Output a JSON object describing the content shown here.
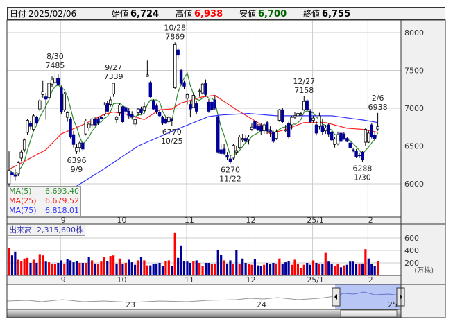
{
  "header": {
    "date_label": "日付",
    "date_value": "2025/02/06",
    "open_label": "始値",
    "open_value": "6,724",
    "high_label": "高値",
    "high_value": "6,938",
    "low_label": "安値",
    "low_value": "6,700",
    "close_label": "終値",
    "close_value": "6,755"
  },
  "colors": {
    "up_volume": "#ff0000",
    "down_volume": "#000099",
    "ma5": "#2e8b2e",
    "ma25": "#ff2020",
    "ma75": "#3333ff",
    "high_text": "#ff0000",
    "low_text": "#006400"
  },
  "legend": [
    {
      "name": "MA(5)",
      "value": "6,693.40"
    },
    {
      "name": "MA(25)",
      "value": "6,679.52"
    },
    {
      "name": "MA(75)",
      "value": "6,818.01"
    }
  ],
  "volume_legend": {
    "label": "出来高",
    "value": "2,315,600株"
  },
  "volume_unit": "(万株)",
  "navigator": {
    "labels": [
      "23",
      "24",
      "25"
    ]
  },
  "chart_data": {
    "type": "candlestick",
    "ylim": [
      5580,
      8150
    ],
    "yticks": [
      "8000",
      "7500",
      "7000",
      "6500",
      "6000"
    ],
    "ytick_values": [
      8000,
      7500,
      7000,
      6500,
      6000
    ],
    "xticks": [
      {
        "label": "9",
        "index": 17
      },
      {
        "label": "10",
        "index": 36
      },
      {
        "label": "11",
        "index": 58
      },
      {
        "label": "12",
        "index": 78
      },
      {
        "label": "25/1",
        "index": 99
      },
      {
        "label": "2",
        "index": 117
      }
    ],
    "candles": [
      [
        6000,
        6430,
        5950,
        6180
      ],
      [
        6150,
        6250,
        6080,
        6120
      ],
      [
        6120,
        6200,
        6040,
        6100
      ],
      [
        6130,
        6300,
        6100,
        6280
      ],
      [
        6340,
        6450,
        6300,
        6420
      ],
      [
        6450,
        6600,
        6420,
        6580
      ],
      [
        6680,
        6860,
        6650,
        6840
      ],
      [
        6800,
        6830,
        6720,
        6760
      ],
      [
        6720,
        6920,
        6700,
        6900
      ],
      [
        6880,
        6900,
        6780,
        6800
      ],
      [
        6990,
        7120,
        6960,
        7100
      ],
      [
        7180,
        7360,
        7140,
        7220
      ],
      [
        7150,
        7200,
        6850,
        7120
      ],
      [
        7140,
        7340,
        7100,
        7330
      ],
      [
        7320,
        7420,
        7280,
        7370
      ],
      [
        7340,
        7485,
        7320,
        7400
      ],
      [
        7400,
        7450,
        7300,
        7310
      ],
      [
        7270,
        7300,
        6920,
        6950
      ],
      [
        6980,
        7220,
        6950,
        7190
      ],
      [
        6880,
        6960,
        6820,
        6940
      ],
      [
        6860,
        6880,
        6600,
        6620
      ],
      [
        6650,
        6700,
        6480,
        6520
      ],
      [
        6430,
        6530,
        6396,
        6480
      ],
      [
        6480,
        6560,
        6420,
        6540
      ],
      [
        6540,
        6560,
        6430,
        6460
      ],
      [
        6660,
        6860,
        6640,
        6830
      ],
      [
        6740,
        6800,
        6700,
        6790
      ],
      [
        6780,
        6880,
        6740,
        6860
      ],
      [
        6850,
        6880,
        6760,
        6780
      ],
      [
        6860,
        6890,
        6780,
        6800
      ],
      [
        6880,
        6900,
        6850,
        6860
      ],
      [
        6920,
        7080,
        6900,
        7040
      ],
      [
        7060,
        7100,
        6950,
        6960
      ],
      [
        7050,
        7150,
        7020,
        7110
      ],
      [
        7190,
        7339,
        7150,
        7330
      ],
      [
        6850,
        6900,
        6800,
        6880
      ],
      [
        6940,
        7060,
        6900,
        7040
      ],
      [
        7020,
        7030,
        6800,
        6820
      ],
      [
        7010,
        7030,
        6930,
        6960
      ],
      [
        6960,
        7000,
        6860,
        6900
      ],
      [
        6920,
        6960,
        6850,
        6880
      ],
      [
        6790,
        6880,
        6750,
        6850
      ],
      [
        6940,
        7000,
        6900,
        6990
      ],
      [
        6990,
        7020,
        6920,
        6940
      ],
      [
        6970,
        7080,
        6930,
        7020
      ],
      [
        7420,
        7630,
        7420,
        7440
      ],
      [
        7340,
        7360,
        7130,
        7150
      ],
      [
        7100,
        7120,
        6980,
        6990
      ],
      [
        7030,
        7060,
        6920,
        6950
      ],
      [
        6950,
        6980,
        6880,
        6900
      ],
      [
        6880,
        6900,
        6780,
        6800
      ],
      [
        6860,
        6880,
        6790,
        6800
      ],
      [
        6820,
        6900,
        6790,
        6880
      ],
      [
        6860,
        6870,
        6770,
        6830
      ],
      [
        7270,
        7869,
        7250,
        7840
      ],
      [
        7770,
        7800,
        7650,
        7700
      ],
      [
        7500,
        7520,
        7300,
        7330
      ],
      [
        7340,
        7360,
        7250,
        7290
      ],
      [
        7130,
        7200,
        7050,
        7180
      ],
      [
        7050,
        7100,
        6880,
        6990
      ],
      [
        7010,
        7200,
        7000,
        7170
      ],
      [
        7060,
        7100,
        6920,
        6960
      ],
      [
        7220,
        7260,
        7150,
        7230
      ],
      [
        7200,
        7340,
        7180,
        7320
      ],
      [
        7330,
        7380,
        7150,
        7180
      ],
      [
        7080,
        7120,
        6940,
        6960
      ],
      [
        7080,
        7100,
        6960,
        6980
      ],
      [
        7110,
        7170,
        6980,
        7000
      ],
      [
        6890,
        6900,
        6400,
        6420
      ],
      [
        6450,
        6520,
        6380,
        6400
      ],
      [
        6460,
        6530,
        6380,
        6400
      ],
      [
        6380,
        6420,
        6320,
        6350
      ],
      [
        6330,
        6380,
        6270,
        6290
      ],
      [
        6340,
        6530,
        6320,
        6510
      ],
      [
        6420,
        6500,
        6380,
        6440
      ],
      [
        6480,
        6650,
        6460,
        6620
      ],
      [
        6580,
        6660,
        6550,
        6600
      ],
      [
        6600,
        6640,
        6540,
        6560
      ],
      [
        6580,
        6650,
        6520,
        6620
      ],
      [
        6720,
        6800,
        6700,
        6750
      ],
      [
        6830,
        6840,
        6720,
        6730
      ],
      [
        6760,
        6790,
        6700,
        6710
      ],
      [
        6770,
        6800,
        6650,
        6700
      ],
      [
        6700,
        6800,
        6660,
        6780
      ],
      [
        6810,
        6830,
        6660,
        6700
      ],
      [
        6700,
        6760,
        6620,
        6680
      ],
      [
        6680,
        6700,
        6540,
        6560
      ],
      [
        6600,
        6720,
        6580,
        6690
      ],
      [
        6840,
        6990,
        6820,
        6980
      ],
      [
        6980,
        7000,
        6800,
        6820
      ],
      [
        6700,
        6780,
        6680,
        6710
      ],
      [
        6800,
        6820,
        6600,
        6620
      ],
      [
        6780,
        6900,
        6720,
        6880
      ],
      [
        6880,
        6950,
        6860,
        6900
      ],
      [
        6900,
        6960,
        6880,
        6930
      ],
      [
        6910,
        6950,
        6900,
        6930
      ],
      [
        6980,
        7158,
        6960,
        7090
      ],
      [
        7100,
        7120,
        6960,
        6980
      ],
      [
        6960,
        6990,
        6800,
        6820
      ],
      [
        6840,
        6900,
        6800,
        6870
      ],
      [
        6780,
        6830,
        6640,
        6670
      ],
      [
        6760,
        6940,
        6720,
        6900
      ],
      [
        6770,
        6860,
        6650,
        6690
      ],
      [
        6700,
        6780,
        6660,
        6740
      ],
      [
        6780,
        6800,
        6620,
        6660
      ],
      [
        6680,
        6700,
        6560,
        6580
      ],
      [
        6520,
        6620,
        6480,
        6590
      ],
      [
        6530,
        6690,
        6510,
        6650
      ],
      [
        6670,
        6690,
        6540,
        6560
      ],
      [
        6660,
        6680,
        6580,
        6600
      ],
      [
        6600,
        6620,
        6550,
        6560
      ],
      [
        6540,
        6560,
        6470,
        6480
      ],
      [
        6450,
        6470,
        6420,
        6440
      ],
      [
        6430,
        6460,
        6340,
        6360
      ],
      [
        6380,
        6410,
        6340,
        6370
      ],
      [
        6420,
        6440,
        6288,
        6320
      ],
      [
        6550,
        6740,
        6500,
        6720
      ],
      [
        6550,
        6700,
        6540,
        6670
      ],
      [
        6780,
        6800,
        6600,
        6620
      ],
      [
        6640,
        6690,
        6580,
        6600
      ],
      [
        6724,
        6938,
        6700,
        6755
      ]
    ],
    "ma25_points": [
      [
        0,
        6190
      ],
      [
        12,
        6450
      ],
      [
        17,
        6660
      ],
      [
        24,
        6780
      ],
      [
        31,
        6920
      ],
      [
        34,
        6950
      ],
      [
        38,
        6920
      ],
      [
        44,
        6850
      ],
      [
        49,
        6980
      ],
      [
        53,
        6990
      ],
      [
        56,
        7070
      ],
      [
        63,
        7150
      ],
      [
        67,
        7170
      ],
      [
        74,
        6980
      ],
      [
        81,
        6810
      ],
      [
        85,
        6660
      ],
      [
        90,
        6720
      ],
      [
        96,
        6810
      ],
      [
        103,
        6810
      ],
      [
        110,
        6735
      ],
      [
        115,
        6720
      ],
      [
        120,
        6680
      ]
    ],
    "ma75_points": [
      [
        22,
        5970
      ],
      [
        31,
        6200
      ],
      [
        42,
        6500
      ],
      [
        54,
        6710
      ],
      [
        65,
        6890
      ],
      [
        69,
        6910
      ],
      [
        78,
        6930
      ],
      [
        87,
        6900
      ],
      [
        96,
        6900
      ],
      [
        105,
        6900
      ],
      [
        115,
        6845
      ],
      [
        120,
        6810
      ]
    ],
    "annotations": [
      {
        "date": "8/30",
        "price": "7485",
        "index": 15,
        "at": "high"
      },
      {
        "date": "9/9",
        "price": "6396",
        "index": 22,
        "at": "low"
      },
      {
        "date": "9/27",
        "price": "7339",
        "index": 34,
        "at": "high"
      },
      {
        "date": "10/25",
        "price": "6770",
        "index": 53,
        "at": "low"
      },
      {
        "date": "10/28",
        "price": "7869",
        "index": 54,
        "at": "high"
      },
      {
        "date": "11/22",
        "price": "6270",
        "index": 72,
        "at": "low"
      },
      {
        "date": "12/27",
        "price": "7158",
        "index": 96,
        "at": "high"
      },
      {
        "date": "1/30",
        "price": "6288",
        "index": 115,
        "at": "low"
      },
      {
        "date": "2/6",
        "price": "6938",
        "index": 120,
        "at": "high"
      }
    ],
    "volume": {
      "yticks": [
        "600",
        "400",
        "200"
      ],
      "ytick_values": [
        600,
        400,
        200
      ],
      "values": [
        440,
        320,
        380,
        250,
        230,
        270,
        280,
        200,
        250,
        200,
        340,
        320,
        220,
        210,
        180,
        180,
        200,
        240,
        190,
        260,
        240,
        210,
        230,
        200,
        200,
        200,
        290,
        240,
        190,
        180,
        220,
        290,
        230,
        310,
        320,
        190,
        270,
        180,
        200,
        250,
        210,
        170,
        240,
        300,
        240,
        160,
        160,
        180,
        190,
        200,
        150,
        230,
        240,
        150,
        680,
        280,
        480,
        230,
        220,
        200,
        230,
        240,
        200,
        150,
        200,
        200,
        180,
        190,
        400,
        330,
        240,
        190,
        240,
        180,
        400,
        180,
        270,
        200,
        180,
        170,
        260,
        160,
        150,
        170,
        200,
        180,
        200,
        190,
        270,
        180,
        210,
        230,
        170,
        250,
        180,
        120,
        170,
        200,
        170,
        240,
        200,
        190,
        180,
        360,
        220,
        180,
        150,
        180,
        130,
        160,
        170,
        220,
        220,
        180,
        190,
        190,
        420,
        270,
        180,
        150,
        232
      ]
    }
  }
}
